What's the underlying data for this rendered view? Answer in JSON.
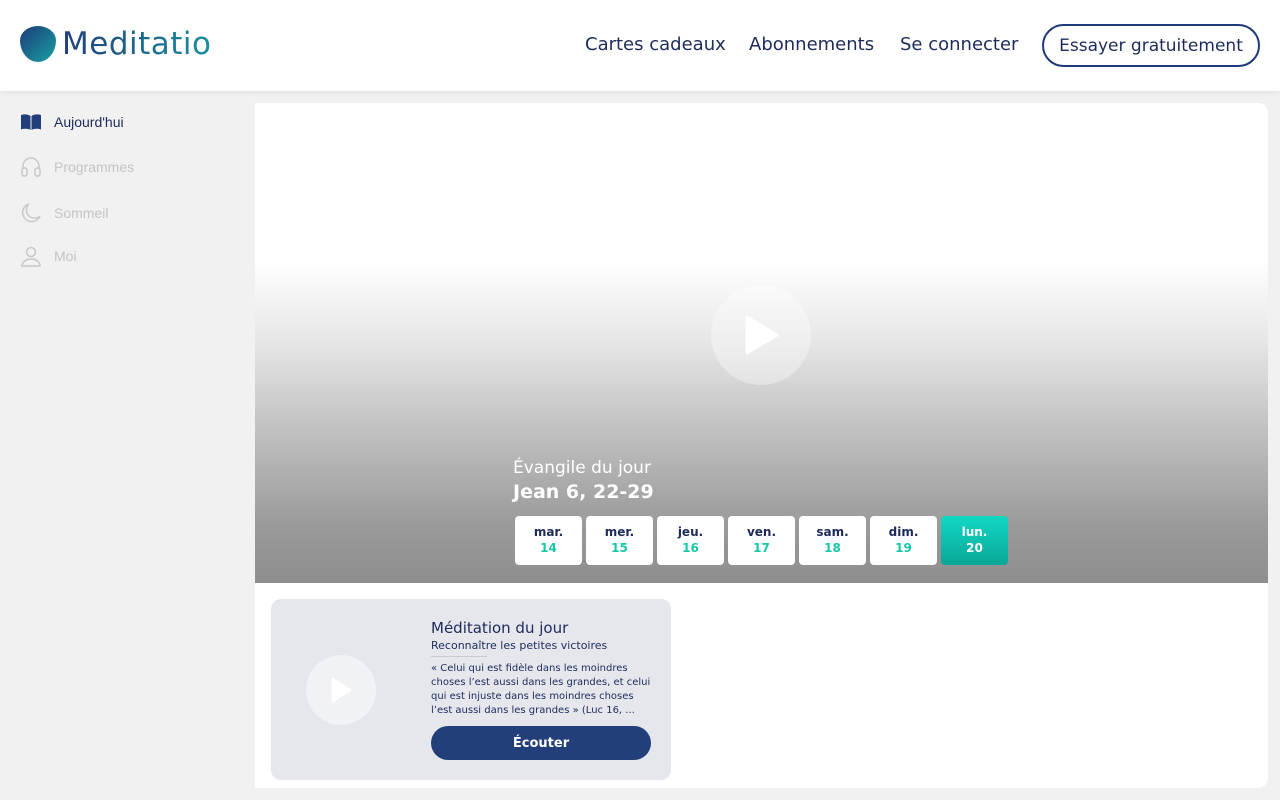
{
  "brand": {
    "name": "Meditatio"
  },
  "header": {
    "links": {
      "gift_cards": "Cartes cadeaux",
      "subscriptions": "Abonnements",
      "login": "Se connecter"
    },
    "cta": "Essayer gratuitement"
  },
  "sidebar": {
    "items": [
      {
        "label": "Aujourd'hui",
        "icon": "open-book-icon",
        "active": true
      },
      {
        "label": "Programmes",
        "icon": "headphones-icon",
        "active": false
      },
      {
        "label": "Sommeil",
        "icon": "moon-icon",
        "active": false
      },
      {
        "label": "Moi",
        "icon": "user-icon",
        "active": false
      }
    ]
  },
  "hero": {
    "kicker": "Évangile du jour",
    "title": "Jean 6, 22-29",
    "play_icon": "play-icon",
    "days": [
      {
        "name": "mar.",
        "date": "14",
        "selected": false
      },
      {
        "name": "mer.",
        "date": "15",
        "selected": false
      },
      {
        "name": "jeu.",
        "date": "16",
        "selected": false
      },
      {
        "name": "ven.",
        "date": "17",
        "selected": false
      },
      {
        "name": "sam.",
        "date": "18",
        "selected": false
      },
      {
        "name": "dim.",
        "date": "19",
        "selected": false
      },
      {
        "name": "lun.",
        "date": "20",
        "selected": true
      }
    ]
  },
  "meditation": {
    "title": "Méditation du jour",
    "subtitle": "Reconnaître les petites victoires",
    "quote": "« Celui qui est fidèle dans les moindres choses l’est aussi dans les grandes, et celui qui est injuste dans les moindres choses l’est aussi dans les grandes »       (Luc 16, ...",
    "button": "Écouter",
    "play_icon": "play-icon"
  },
  "colors": {
    "navy": "#1e2a5a",
    "accent_teal": "#14c8a8",
    "button_blue": "#223f7a",
    "sidebar_bg": "#f1f1f1"
  }
}
